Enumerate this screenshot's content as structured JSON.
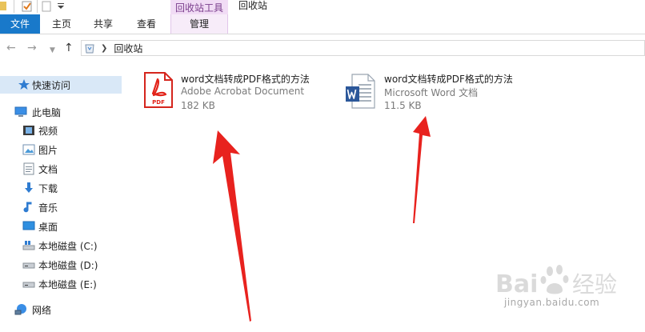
{
  "ribbon": {
    "context_header": "回收站工具",
    "window_title": "回收站",
    "tabs": {
      "file": "文件",
      "home": "主页",
      "share": "共享",
      "view": "查看",
      "manage": "管理"
    }
  },
  "address": {
    "location": "回收站"
  },
  "sidebar": {
    "quick_access": "快速访问",
    "this_pc": "此电脑",
    "videos": "视频",
    "pictures": "图片",
    "documents": "文档",
    "downloads": "下载",
    "music": "音乐",
    "desktop": "桌面",
    "drive_c": "本地磁盘 (C:)",
    "drive_d": "本地磁盘 (D:)",
    "drive_e": "本地磁盘 (E:)",
    "network": "网络"
  },
  "files": [
    {
      "name": "word文档转成PDF格式的方法",
      "type": "Adobe Acrobat Document",
      "size": "182 KB",
      "icon": "pdf-file-icon"
    },
    {
      "name": "word文档转成PDF格式的方法",
      "type": "Microsoft Word 文档",
      "size": "11.5 KB",
      "icon": "word-file-icon"
    }
  ],
  "colors": {
    "file_tab": "#1979ca",
    "context_tab": "#f1dcf5",
    "selection": "#d9e8f7",
    "arrow": "#e8221e",
    "pdf_red": "#e2231a",
    "word_blue": "#2b579a"
  },
  "watermark": {
    "brand": "Bai 经验",
    "url": "jingyan.baidu.com"
  }
}
